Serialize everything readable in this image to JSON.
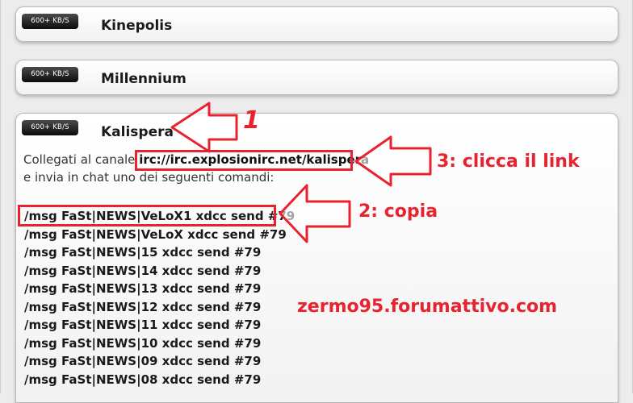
{
  "servers": [
    {
      "speed": "600+ KB/S",
      "name": "Kinepolis"
    },
    {
      "speed": "600+ KB/S",
      "name": "Millennium"
    },
    {
      "speed": "600+ KB/S",
      "name": "Kalispera"
    }
  ],
  "instructions": {
    "line1_prefix": "Collegati al canale",
    "channel_link": "irc://irc.explosionirc.net/kalispera",
    "line2": "e invia in chat uno dei seguenti comandi:"
  },
  "commands": [
    "/msg FaSt|NEWS|VeLoX1 xdcc send #79",
    "/msg FaSt|NEWS|VeLoX xdcc send #79",
    "/msg FaSt|NEWS|15 xdcc send #79",
    "/msg FaSt|NEWS|14 xdcc send #79",
    "/msg FaSt|NEWS|13 xdcc send #79",
    "/msg FaSt|NEWS|12 xdcc send #79",
    "/msg FaSt|NEWS|11 xdcc send #79",
    "/msg FaSt|NEWS|10 xdcc send #79",
    "/msg FaSt|NEWS|09 xdcc send #79",
    "/msg FaSt|NEWS|08 xdcc send #79"
  ],
  "annotations": {
    "step1": "1",
    "step2": "2: copia",
    "step3": "3: clicca il link",
    "watermark": "zermo95.forumattivo.com",
    "color": "#e8232f"
  }
}
